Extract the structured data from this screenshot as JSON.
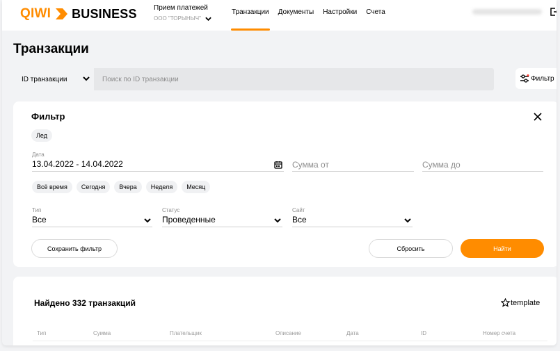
{
  "header": {
    "logo_brand": "QIWI",
    "logo_suffix": "BUSINESS",
    "account_label": "Прием платежей",
    "account_name": "ООО \"ТОРЫНЫЧ\"",
    "nav": [
      "Транзакции",
      "Документы",
      "Настройки",
      "Счета"
    ],
    "active_nav": "Транзакции"
  },
  "page_title": "Транзакции",
  "search": {
    "type_select": "ID транзакции",
    "placeholder": "Поиск по ID транзакции",
    "filter_button": "Фильтр"
  },
  "filter": {
    "title": "Фильтр",
    "active_chip": "Лед",
    "date_label": "Дата",
    "date_value": "13.04.2022 - 14.04.2022",
    "sum_from_placeholder": "Сумма от",
    "sum_to_placeholder": "Сумма до",
    "periods": [
      "Всё время",
      "Сегодня",
      "Вчера",
      "Неделя",
      "Месяц"
    ],
    "type_label": "Тип",
    "type_value": "Все",
    "status_label": "Статус",
    "status_value": "Проведенные",
    "site_label": "Сайт",
    "site_value": "Все",
    "save_button": "Сохранить фильтр",
    "reset_button": "Сбросить",
    "find_button": "Найти"
  },
  "results": {
    "found_text": "Найдено 332 транзакций",
    "template_button": "template",
    "columns": [
      "Тип",
      "Сумма",
      "Плательщик",
      "Описание",
      "Дата",
      "ID",
      "Номер счета"
    ]
  },
  "colors": {
    "accent": "#ff8c00",
    "background": "#f2f3f5"
  }
}
